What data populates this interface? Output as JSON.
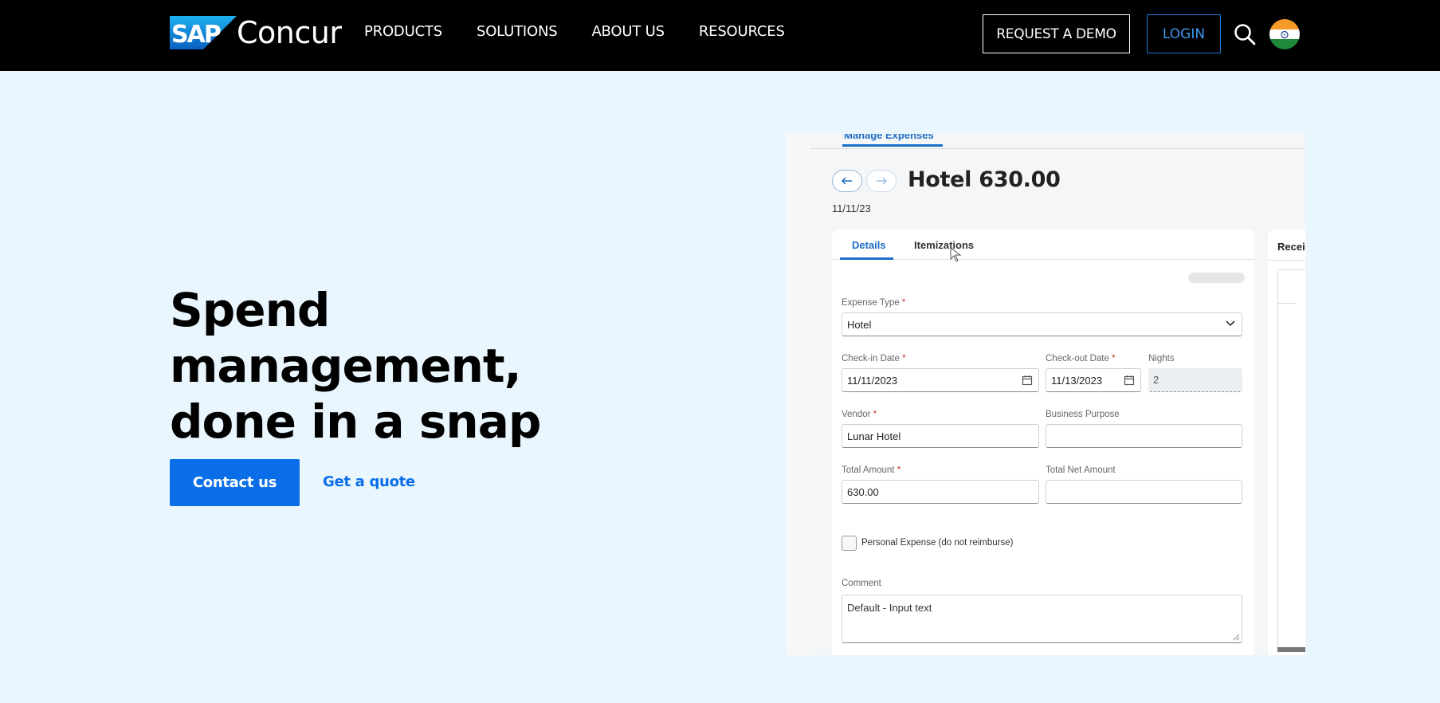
{
  "nav": {
    "logo_badge": "SAP",
    "logo_text": "Concur",
    "menu": [
      "PRODUCTS",
      "SOLUTIONS",
      "ABOUT US",
      "RESOURCES"
    ],
    "request_demo": "REQUEST A DEMO",
    "login": "LOGIN",
    "search_icon": "search-icon",
    "flag_icon": "india-flag-icon"
  },
  "hero": {
    "title_line1": "Spend management,",
    "title_line2": "done in a snap",
    "contact_button": "Contact us",
    "quote_link": "Get a quote"
  },
  "mockup": {
    "top_tab": "Manage Expenses",
    "title": "Hotel 630.00",
    "date": "11/11/23",
    "tabs": [
      "Details",
      "Itemizations"
    ],
    "expense_type_label": "Expense Type",
    "expense_type_value": "Hotel",
    "checkin_label": "Check-in Date",
    "checkin_value": "11/11/2023",
    "checkout_label": "Check-out Date",
    "checkout_value": "11/13/2023",
    "nights_label": "Nights",
    "nights_value": "2",
    "vendor_label": "Vendor",
    "vendor_value": "Lunar Hotel",
    "purpose_label": "Business Purpose",
    "purpose_value": "",
    "total_label": "Total Amount",
    "total_value": "630.00",
    "net_label": "Total Net Amount",
    "net_value": "",
    "personal_label": "Personal Expense (do not reimburse)",
    "comment_label": "Comment",
    "comment_value": "Default - Input text",
    "required_mark": "*",
    "side_card_title": "Recei"
  },
  "colors": {
    "nav_bg": "#000000",
    "hero_bg": "#eaf6fe",
    "accent_blue": "#0a6ee8",
    "login_blue": "#3f96ef"
  }
}
